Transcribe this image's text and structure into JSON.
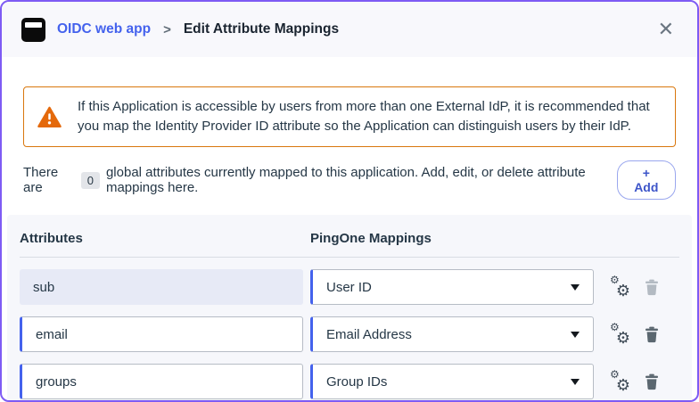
{
  "header": {
    "app_name": "OIDC web app",
    "separator": ">",
    "title": "Edit Attribute Mappings",
    "close_icon": "✕"
  },
  "warning": {
    "message": "If this Application is accessible by users from more than one External IdP, it is recommended that you map the Identity Provider ID attribute so the Application can distinguish users by their IdP."
  },
  "summary": {
    "prefix": "There are",
    "count": "0",
    "suffix": "global attributes currently mapped to this application. Add, edit, or delete attribute mappings here.",
    "add_button": "+ Add"
  },
  "table": {
    "headers": {
      "attributes": "Attributes",
      "mappings": "PingOne Mappings"
    },
    "rows": [
      {
        "attribute": "sub",
        "mapping": "User ID",
        "readonly": true
      },
      {
        "attribute": "email",
        "mapping": "Email Address",
        "readonly": false
      },
      {
        "attribute": "groups",
        "mapping": "Group IDs",
        "readonly": false
      }
    ]
  },
  "icons": {
    "gear": "⚙"
  },
  "colors": {
    "dialog_border_purple": "#7E5BF4",
    "link_blue": "#4462ED",
    "accent_blue": "#4462ED",
    "warning_orange": "#D9770D",
    "text_dark": "#253746",
    "panel_bg": "#F6F7FB",
    "readonly_field_bg": "#E7EAF6"
  }
}
